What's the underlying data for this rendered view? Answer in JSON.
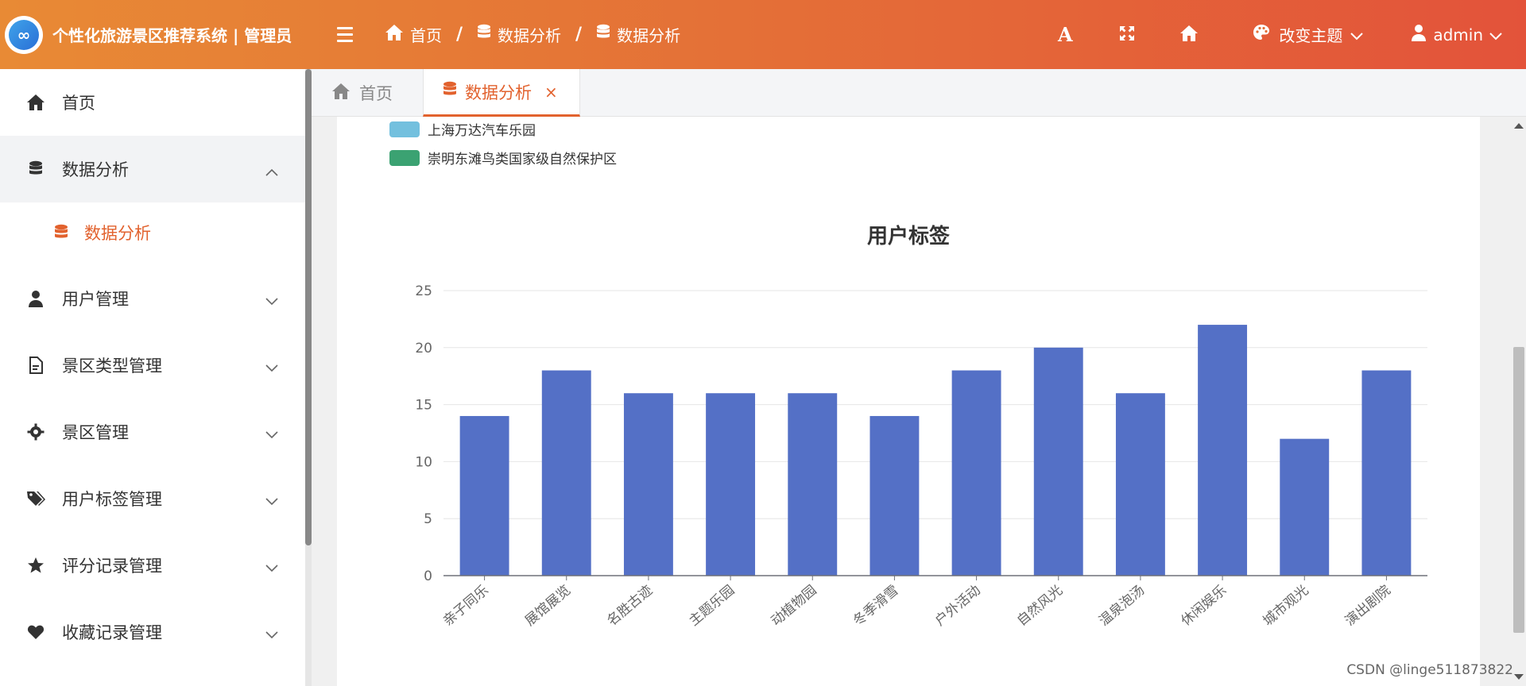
{
  "header": {
    "title": "个性化旅游景区推荐系统 | 管理员",
    "logo_text": "∞",
    "breadcrumbs": [
      "首页",
      "数据分析",
      "数据分析"
    ],
    "actions": {
      "font_icon": "font-icon",
      "fullscreen_icon": "fullscreen-icon",
      "home_icon": "home-icon",
      "theme_label": "改变主题",
      "user_label": "admin"
    }
  },
  "sidebar": {
    "items": [
      {
        "label": "首页",
        "icon": "home-icon"
      },
      {
        "label": "数据分析",
        "icon": "database-icon",
        "expanded": true
      },
      {
        "label": "用户管理",
        "icon": "user-icon"
      },
      {
        "label": "景区类型管理",
        "icon": "file-icon"
      },
      {
        "label": "景区管理",
        "icon": "gear-icon"
      },
      {
        "label": "用户标签管理",
        "icon": "tags-icon"
      },
      {
        "label": "评分记录管理",
        "icon": "star-icon"
      },
      {
        "label": "收藏记录管理",
        "icon": "heart-icon"
      }
    ],
    "subitems": [
      {
        "label": "数据分析",
        "icon": "database-icon",
        "active": true
      }
    ]
  },
  "tabs": [
    {
      "label": "首页",
      "icon": "home-icon",
      "active": false
    },
    {
      "label": "数据分析",
      "icon": "database-icon",
      "active": true,
      "close": "×"
    }
  ],
  "legend_partial": [
    {
      "label": "上海万达汽车乐园",
      "color": "#73c0de"
    },
    {
      "label": "崇明东滩鸟类国家级自然保护区",
      "color": "#3ba272"
    }
  ],
  "chart_data": {
    "type": "bar",
    "title": "用户标签",
    "categories": [
      "亲子同乐",
      "展馆展览",
      "名胜古迹",
      "主题乐园",
      "动植物园",
      "冬季滑雪",
      "户外活动",
      "自然风光",
      "温泉泡汤",
      "休闲娱乐",
      "城市观光",
      "演出剧院"
    ],
    "values": [
      14,
      18,
      16,
      16,
      16,
      14,
      18,
      20,
      16,
      22,
      12,
      18
    ],
    "ylim": [
      0,
      25
    ],
    "yticks": [
      0,
      5,
      10,
      15,
      20,
      25
    ],
    "bar_color": "#5470c6",
    "grid": true
  },
  "colors": {
    "accent": "#e2622e",
    "header_start": "#e88a35",
    "header_end": "#e3533a"
  },
  "watermark": "CSDN @linge511873822"
}
